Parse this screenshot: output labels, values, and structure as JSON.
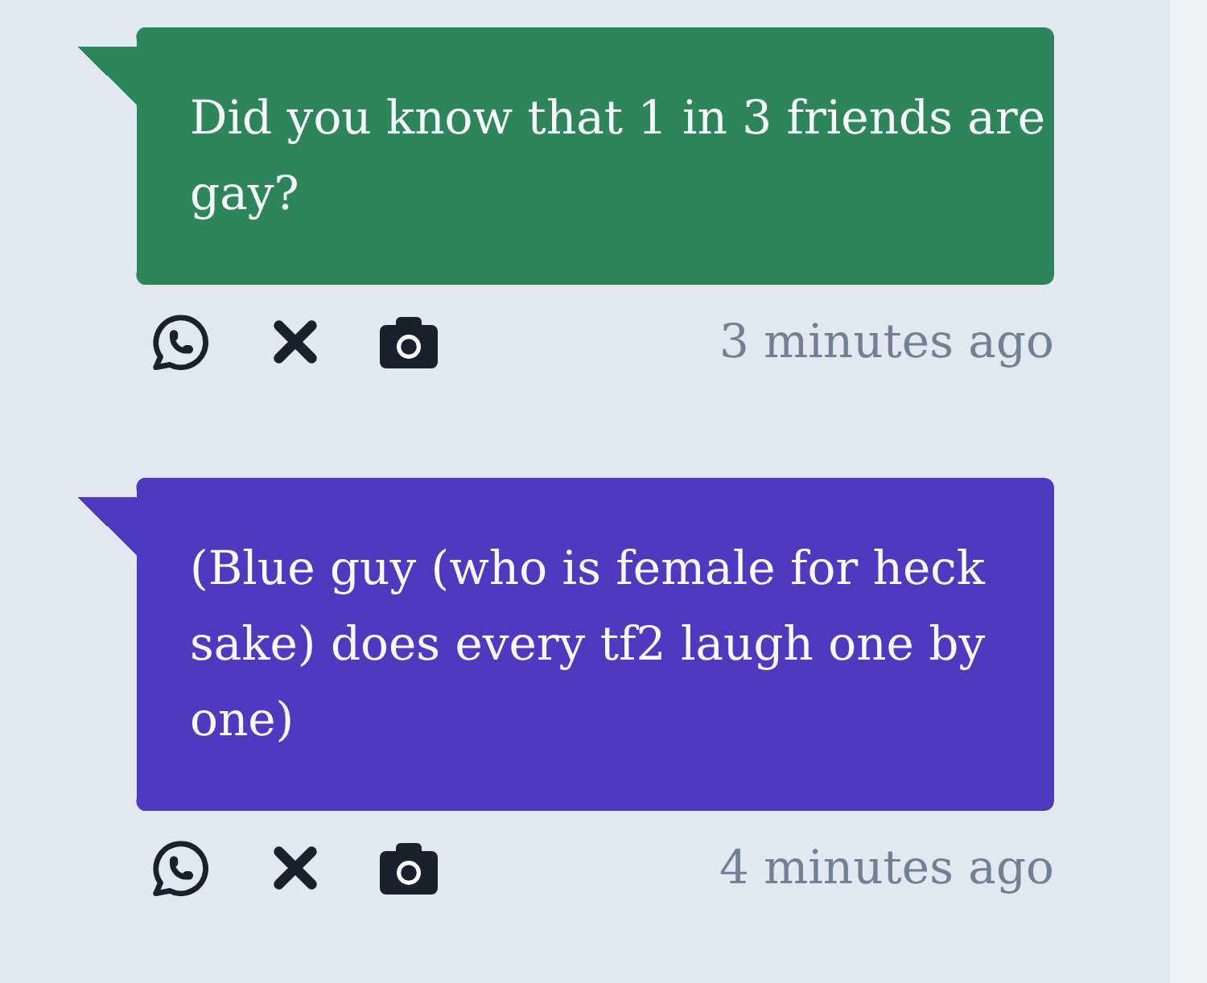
{
  "messages": [
    {
      "text": "Did you know that 1 in 3 friends are gay?",
      "color": "#2f855a",
      "time": "3 minutes ago"
    },
    {
      "text": "(Blue guy (who is female for heck sake) does every tf2 laugh one by one)",
      "color": "#4e3abe",
      "time": "4 minutes ago"
    }
  ]
}
